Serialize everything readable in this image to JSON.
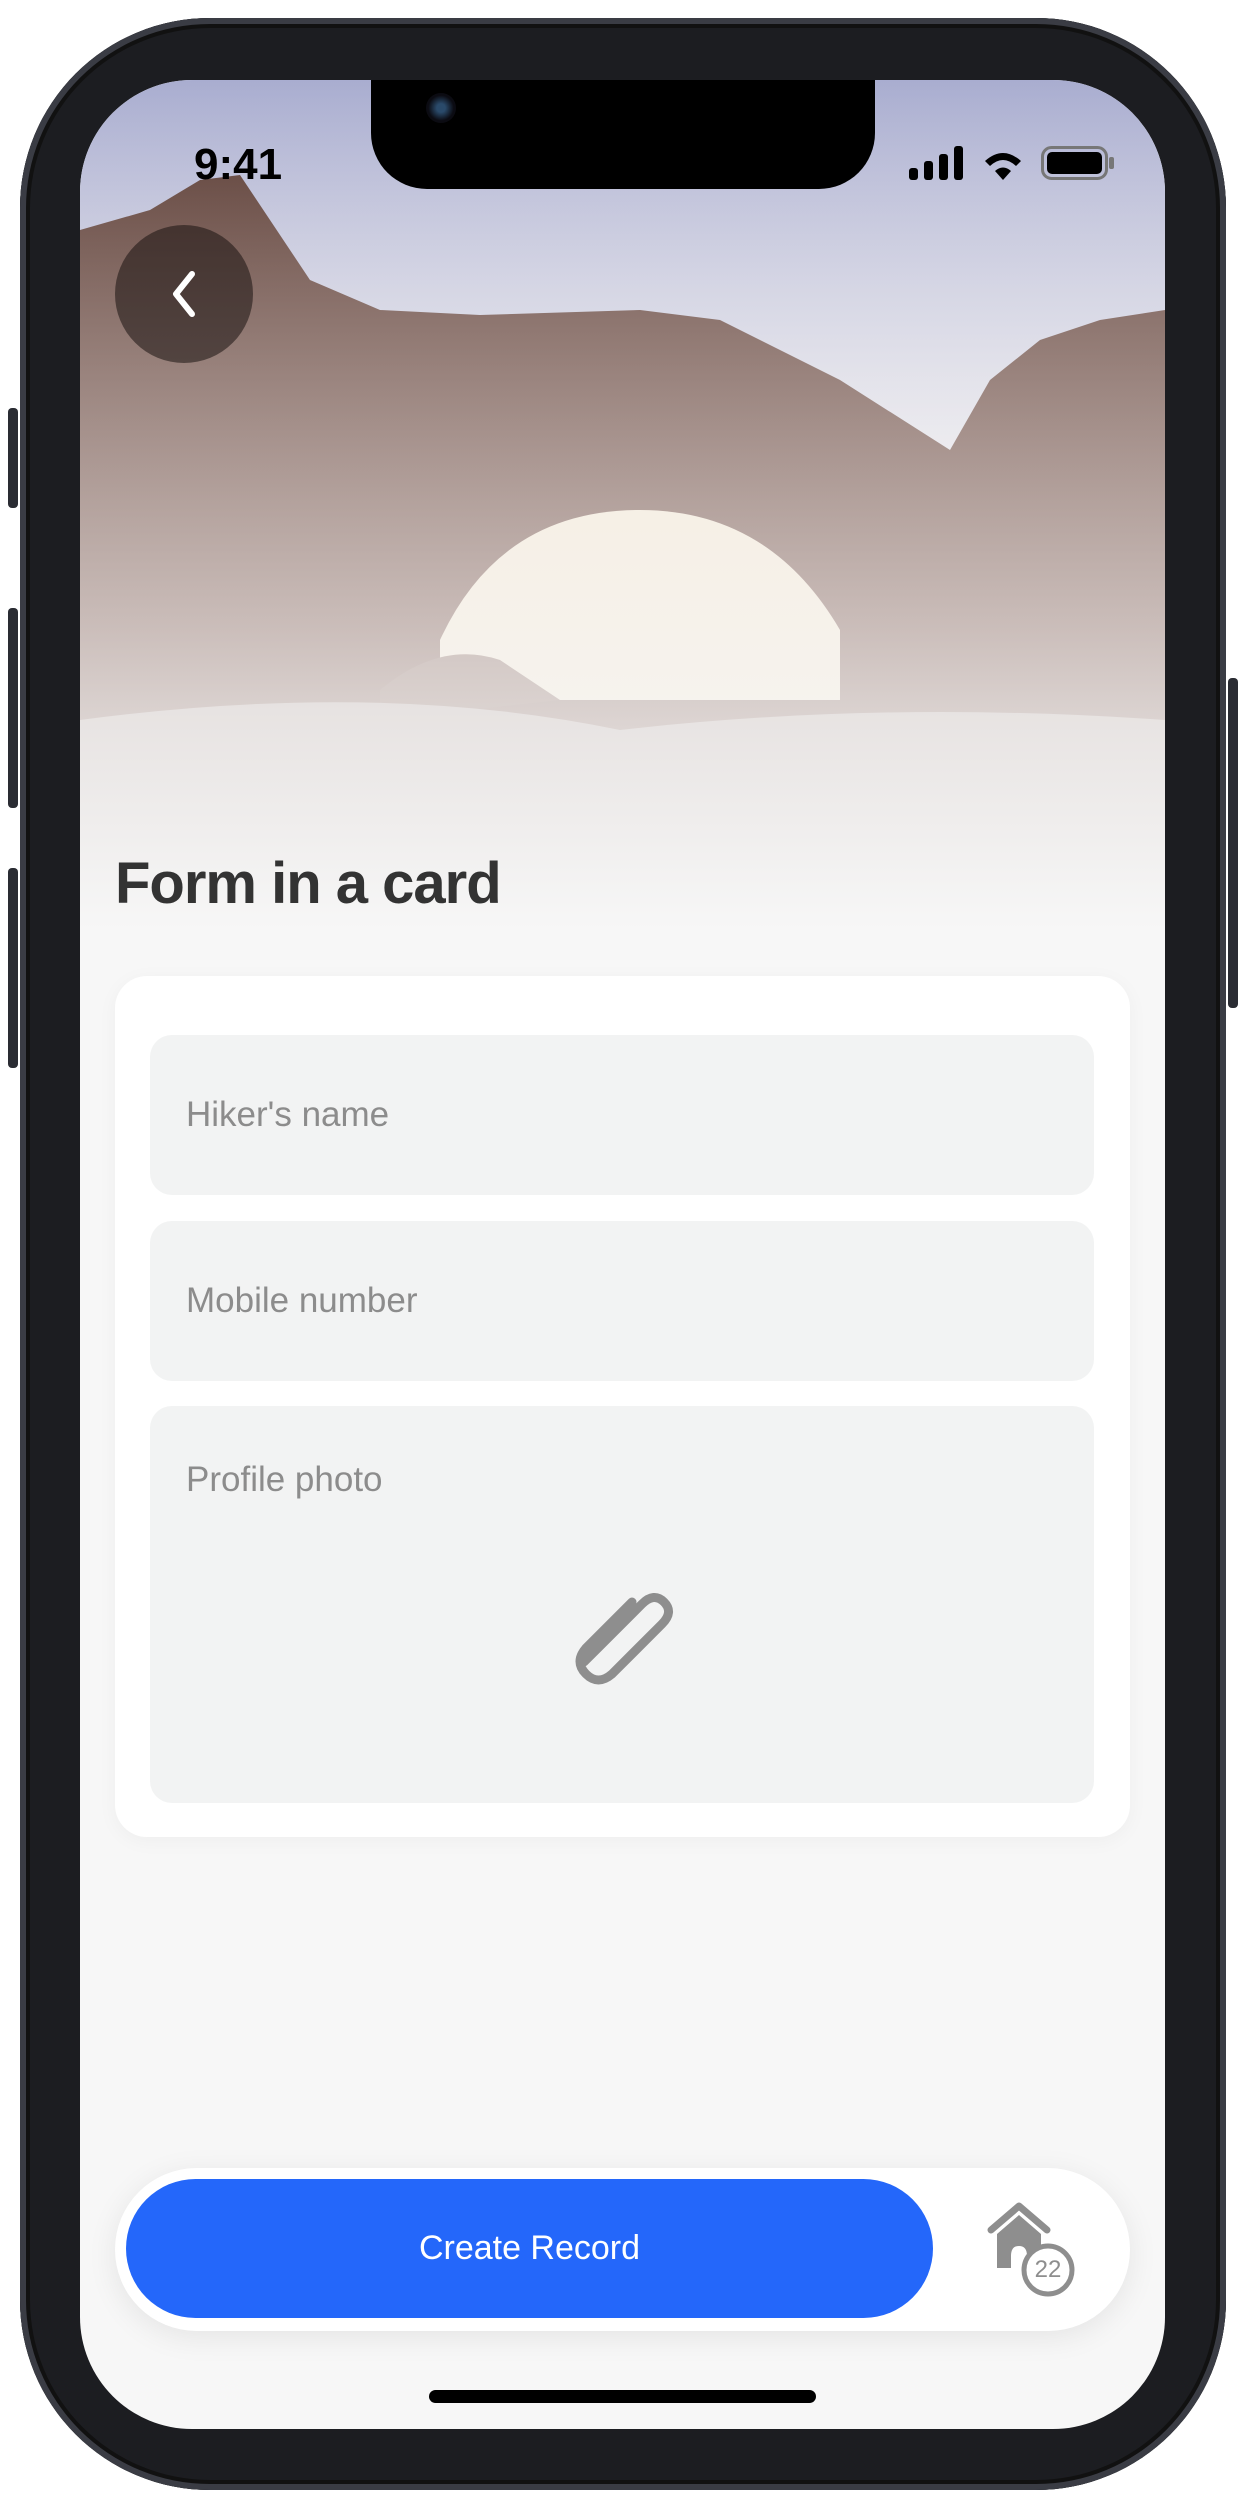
{
  "status_bar": {
    "time": "9:41"
  },
  "header": {
    "title": "Form in a card",
    "back_icon": "chevron-left-icon"
  },
  "form": {
    "fields": [
      {
        "placeholder": "Hiker's name"
      },
      {
        "placeholder": "Mobile number"
      },
      {
        "placeholder": "Profile photo",
        "icon": "paperclip-icon"
      }
    ]
  },
  "bottom_bar": {
    "create_label": "Create Record",
    "home_icon": "home-icon",
    "home_badge": "22"
  },
  "colors": {
    "accent": "#2467fa",
    "field_bg": "#f2f3f3",
    "page_bg": "#f7f7f7"
  }
}
